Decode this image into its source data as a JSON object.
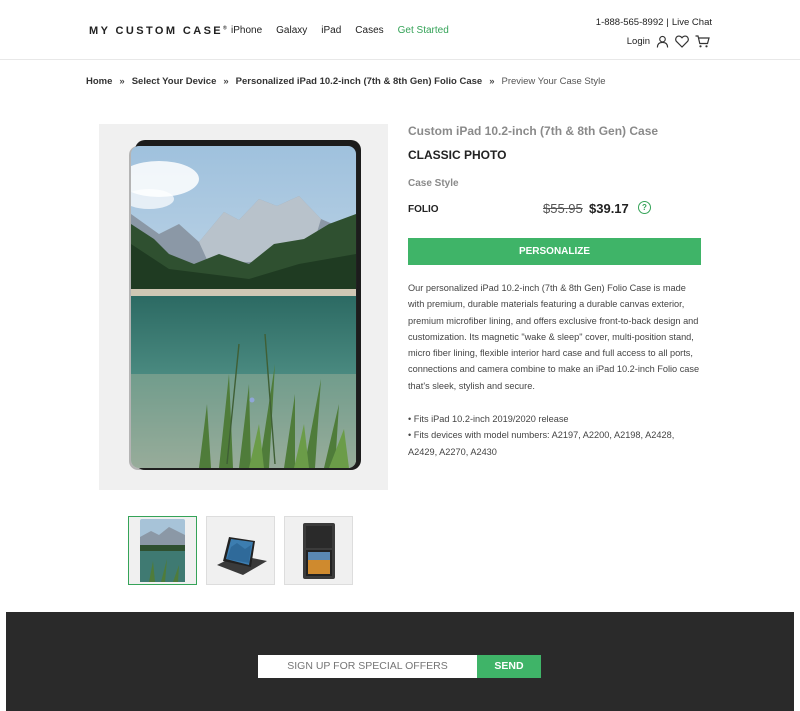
{
  "header": {
    "logo": "MY CUSTOM CASE",
    "nav": [
      "iPhone",
      "Galaxy",
      "iPad",
      "Cases",
      "Get Started"
    ],
    "phone": "1-888-565-8992",
    "live_chat": "Live Chat",
    "login": "Login"
  },
  "breadcrumb": {
    "items": [
      "Home",
      "Select Your Device",
      "Personalized iPad 10.2-inch (7th & 8th Gen) Folio Case"
    ],
    "current": "Preview Your Case Style",
    "separator": "»"
  },
  "product": {
    "subtitle": "Custom iPad 10.2-inch (7th & 8th Gen) Case",
    "title": "CLASSIC PHOTO",
    "case_style_label": "Case Style",
    "style": "FOLIO",
    "old_price": "$55.95",
    "new_price": "$39.17",
    "help": "?",
    "personalize": "PERSONALIZE",
    "description": "Our personalized iPad 10.2-inch (7th & 8th Gen) Folio Case is made with premium, durable materials featuring a durable canvas exterior, premium microfiber lining, and offers exclusive front-to-back design and customization. Its magnetic \"wake & sleep\" cover, multi-position stand, micro fiber lining, flexible interior hard case and full access to all ports, connections and camera combine to make an iPad 10.2-inch Folio case that's sleek, stylish and secure.",
    "bullets": [
      "• Fits iPad 10.2-inch 2019/2020 release",
      "• Fits devices with model numbers: A2197, A2200, A2198, A2428, A2429, A2270, A2430"
    ]
  },
  "footer": {
    "signup_placeholder": "SIGN UP FOR SPECIAL OFFERS",
    "send": "SEND"
  },
  "colors": {
    "accent": "#3fb468",
    "footer_bg": "#2a2a2a"
  }
}
